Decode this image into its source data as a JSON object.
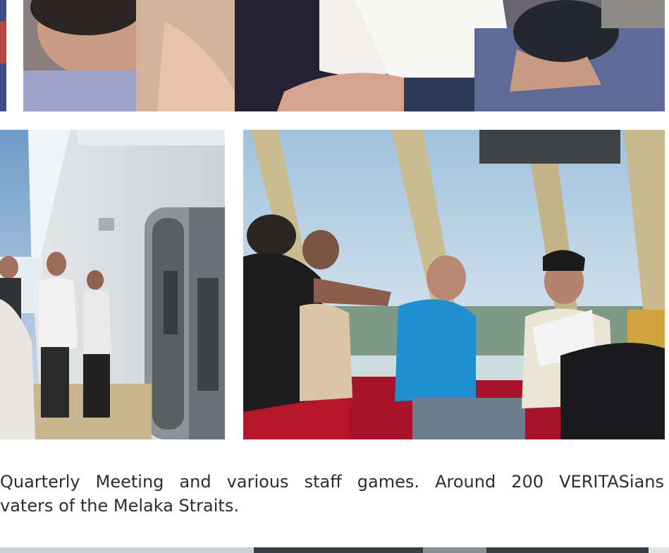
{
  "caption": {
    "line1": "Quarterly Meeting and various staff games. Around 200 VERITASians",
    "line2": "vaters of the Melaka Straits."
  },
  "colors": {
    "text": "#2d2d2d",
    "background": "#ffffff",
    "shirt_blue": "#1f8fcf",
    "seat_red": "#b5162a",
    "sky": "#b9d3e6"
  }
}
